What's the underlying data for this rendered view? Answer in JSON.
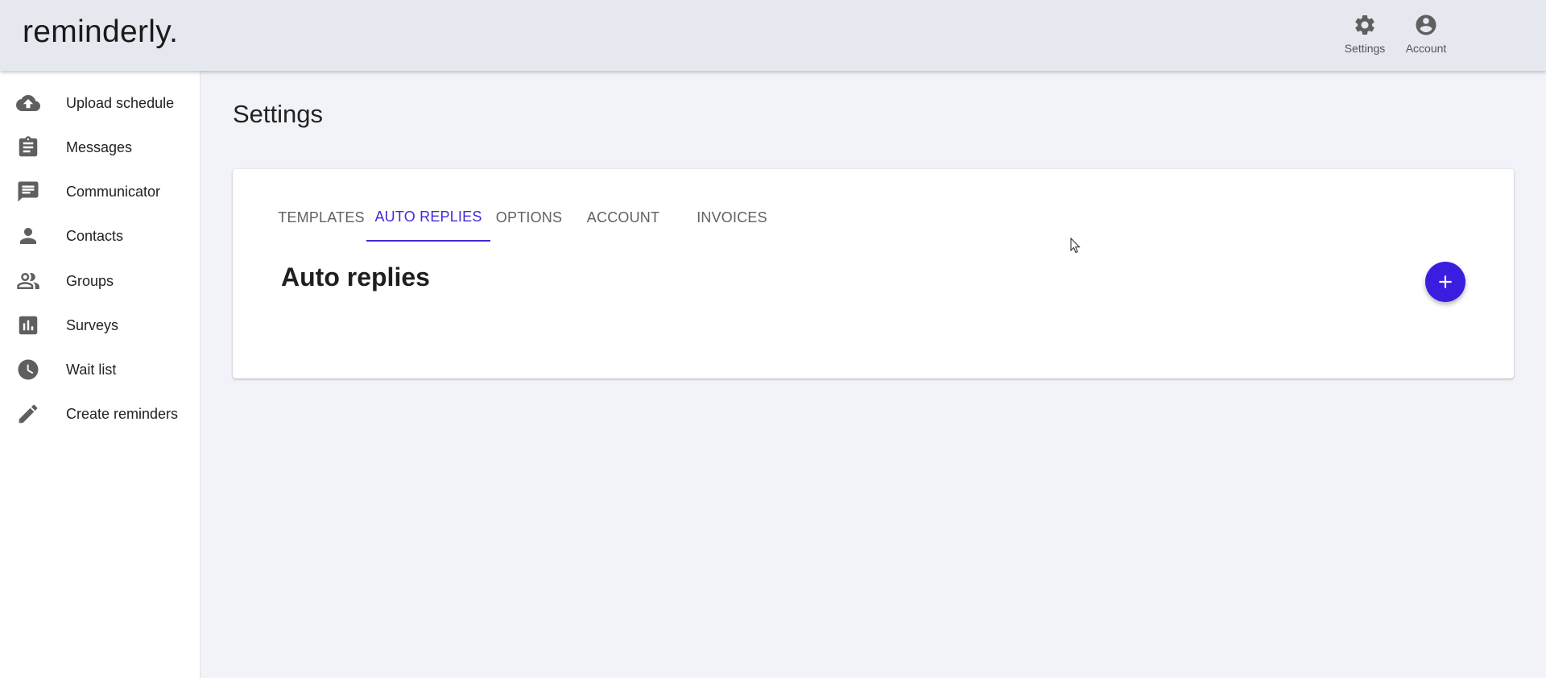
{
  "app": {
    "logo": "reminderly."
  },
  "header": {
    "actions": [
      {
        "label": "Settings",
        "icon": "gear-icon"
      },
      {
        "label": "Account",
        "icon": "account-circle-icon"
      }
    ]
  },
  "sidebar": {
    "items": [
      {
        "label": "Upload schedule",
        "icon": "cloud-upload-icon"
      },
      {
        "label": "Messages",
        "icon": "clipboard-icon"
      },
      {
        "label": "Communicator",
        "icon": "chat-icon"
      },
      {
        "label": "Contacts",
        "icon": "person-icon"
      },
      {
        "label": "Groups",
        "icon": "people-icon"
      },
      {
        "label": "Surveys",
        "icon": "bar-chart-icon"
      },
      {
        "label": "Wait list",
        "icon": "clock-icon"
      },
      {
        "label": "Create reminders",
        "icon": "pencil-icon"
      }
    ]
  },
  "main": {
    "title": "Settings",
    "tabs": [
      {
        "label": "TEMPLATES",
        "active": false
      },
      {
        "label": "AUTO REPLIES",
        "active": true
      },
      {
        "label": "OPTIONS",
        "active": false
      },
      {
        "label": "ACCOUNT",
        "active": false
      },
      {
        "label": "INVOICES",
        "active": false
      }
    ],
    "section_title": "Auto replies",
    "add_button_icon": "plus-icon"
  },
  "colors": {
    "accent": "#3f2bd6",
    "fab": "#3a1ee0",
    "header_bg": "#e6e8f0",
    "page_bg": "#f2f3f8"
  }
}
